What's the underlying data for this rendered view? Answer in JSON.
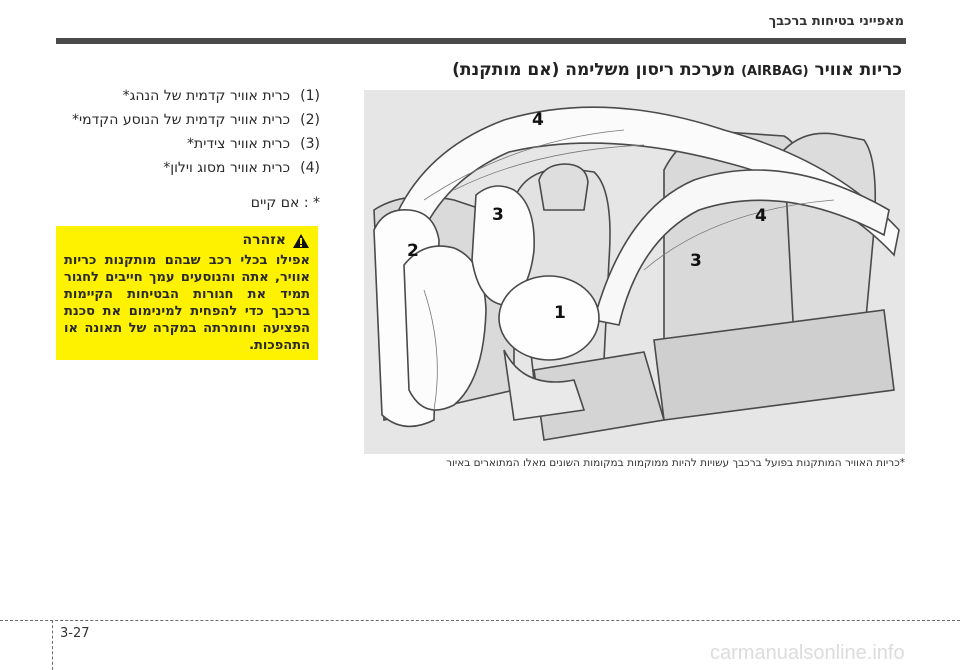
{
  "header": {
    "section": "מאפייני בטיחות ברכבך"
  },
  "title": {
    "he": "כריות אוויר",
    "en": "(AIRBAG)",
    "rest": "מערכת ריסון משלימה (אם מותקנת)"
  },
  "items": [
    {
      "num": "(1)",
      "text": "כרית אוויר קדמית של הנהג*"
    },
    {
      "num": "(2)",
      "text": "כרית אוויר קדמית של הנוסע הקדמי*"
    },
    {
      "num": "(3)",
      "text": "כרית אוויר צידית*"
    },
    {
      "num": "(4)",
      "text": "כרית אוויר מסוג וילון*"
    }
  ],
  "note": "* : אם קיים",
  "warning": {
    "title": "אזהרה",
    "body": "אפילו בכלי רכב שבהם מותקנות כריות אוויר, אתה והנוסעים עמך חייבים לחגור תמיד את חגורות הבטיחות הקיימות ברכבך כדי להפחית למינימום את סכנת הפציעה וחומרתה במקרה של תאונה או התהפכות."
  },
  "figure": {
    "labels": [
      "1",
      "2",
      "3",
      "3",
      "4",
      "4"
    ]
  },
  "caption": "*כריות האוויר המותקנות בפועל ברכבך עשויות להיות ממוקמות במקומות השונים מאלו המתוארים באיור",
  "page_number": "3-27",
  "watermark": "carmanualsonline.info"
}
